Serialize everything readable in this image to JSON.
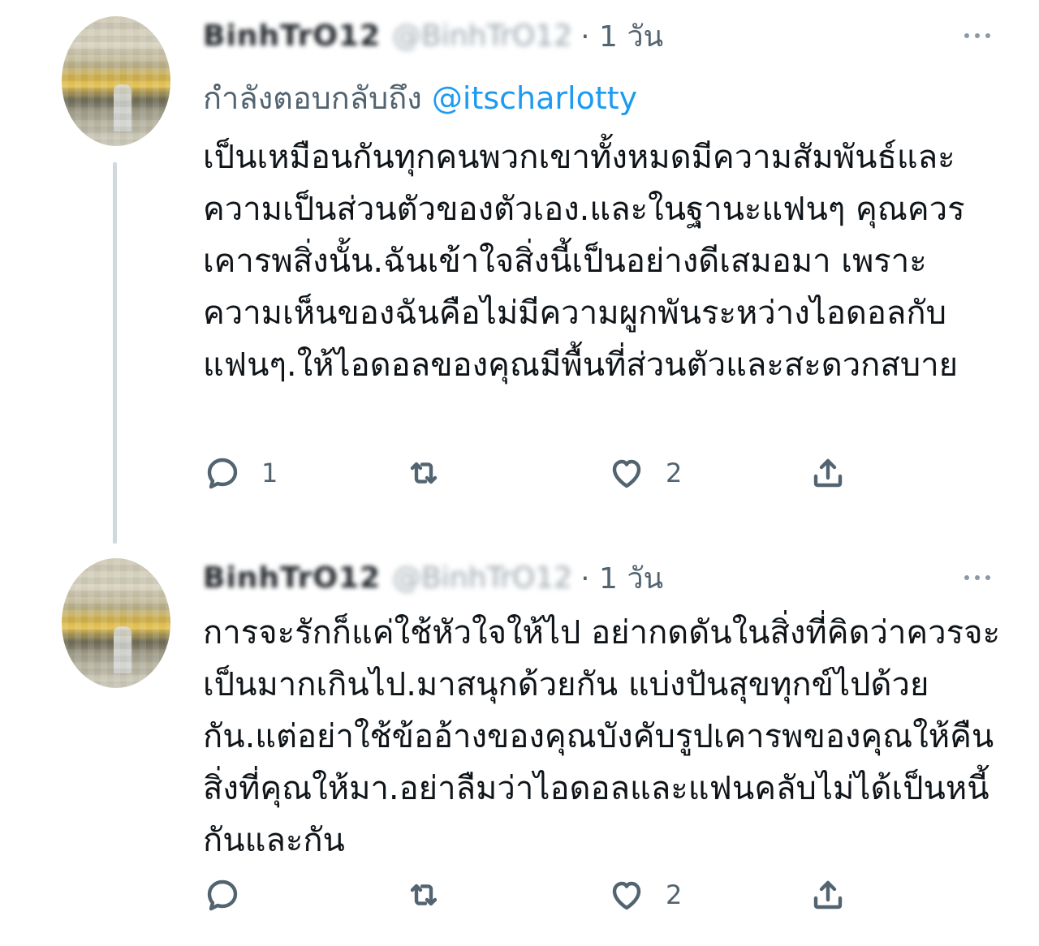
{
  "tweets": [
    {
      "display_name": "BinhTrO12",
      "handle": "@BinhTrO12",
      "time": "· 1 วัน",
      "reply_to_prefix": "กำลังตอบกลับถึง",
      "reply_to_mention": "@itscharlotty",
      "body": "เป็นเหมือนกันทุกคนพวกเขาทั้งหมดมีความสัมพันธ์และความเป็นส่วนตัวของตัวเอง.และในฐานะแฟนๆ คุณควรเคารพสิ่งนั้น.ฉันเข้าใจสิ่งนี้เป็นอย่างดีเสมอมา เพราะความเห็นของฉันคือไม่มีความผูกพันระหว่างไอดอลกับแฟนๆ.ให้ไอดอลของคุณมีพื้นที่ส่วนตัวและสะดวกสบาย",
      "actions": {
        "reply_count": "1",
        "retweet_count": "",
        "like_count": "2"
      }
    },
    {
      "display_name": "BinhTrO12",
      "handle": "@BinhTrO12",
      "time": "· 1 วัน",
      "body": "การจะรักก็แค่ใช้หัวใจให้ไป อย่ากดดันในสิ่งที่คิดว่าควรจะเป็นมากเกินไป.มาสนุกด้วยกัน แบ่งปันสุขทุกข์ไปด้วยกัน.แต่อย่าใช้ข้ออ้างของคุณบังคับรูปเคารพของคุณให้คืนสิ่งที่คุณให้มา.อย่าลืมว่าไอดอลและแฟนคลับไม่ได้เป็นหนี้กันและกัน",
      "actions": {
        "reply_count": "",
        "retweet_count": "",
        "like_count": "2"
      }
    }
  ],
  "icons": {
    "reply": "speech-bubble-icon",
    "retweet": "retweet-arrows-icon",
    "like": "heart-icon",
    "share": "share-upload-icon",
    "more": "more-dots-icon"
  },
  "colors": {
    "link": "#1d9bf0",
    "secondary_text": "#536471",
    "thread_line": "#cfd9de"
  }
}
